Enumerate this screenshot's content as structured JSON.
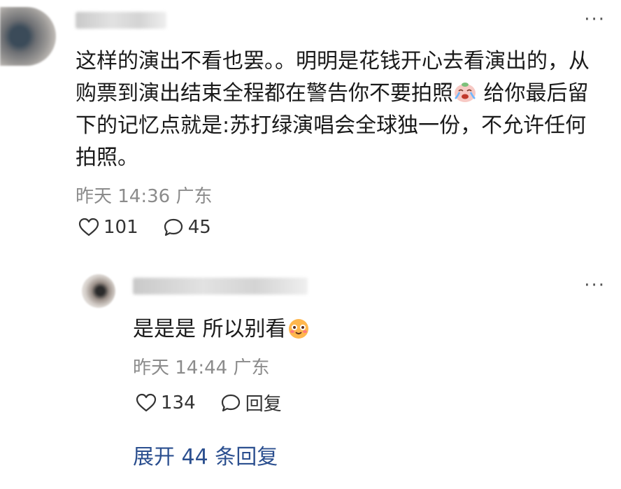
{
  "comment": {
    "text": "这样的演出不看也罢。。明明是花钱开心去看演出的，从购票到演出结束全程都在警告你不要拍照",
    "text_after_emoji": " 给你最后留下的记忆点就是:苏打绿演唱会全球独一份，不允许任何拍照。",
    "time": "昨天 14:36",
    "location": "广东",
    "likes": "101",
    "replies": "45"
  },
  "reply": {
    "text": "是是是 所以别看",
    "time": "昨天 14:44",
    "location": "广东",
    "likes": "134",
    "reply_label": "回复"
  },
  "expand_label": "展开 44 条回复",
  "icons": {
    "like": "heart-icon",
    "comment": "speech-bubble-icon",
    "more": "more-dots-icon",
    "emoji1": "crying-face-icon",
    "emoji2": "smiling-face-icon"
  }
}
